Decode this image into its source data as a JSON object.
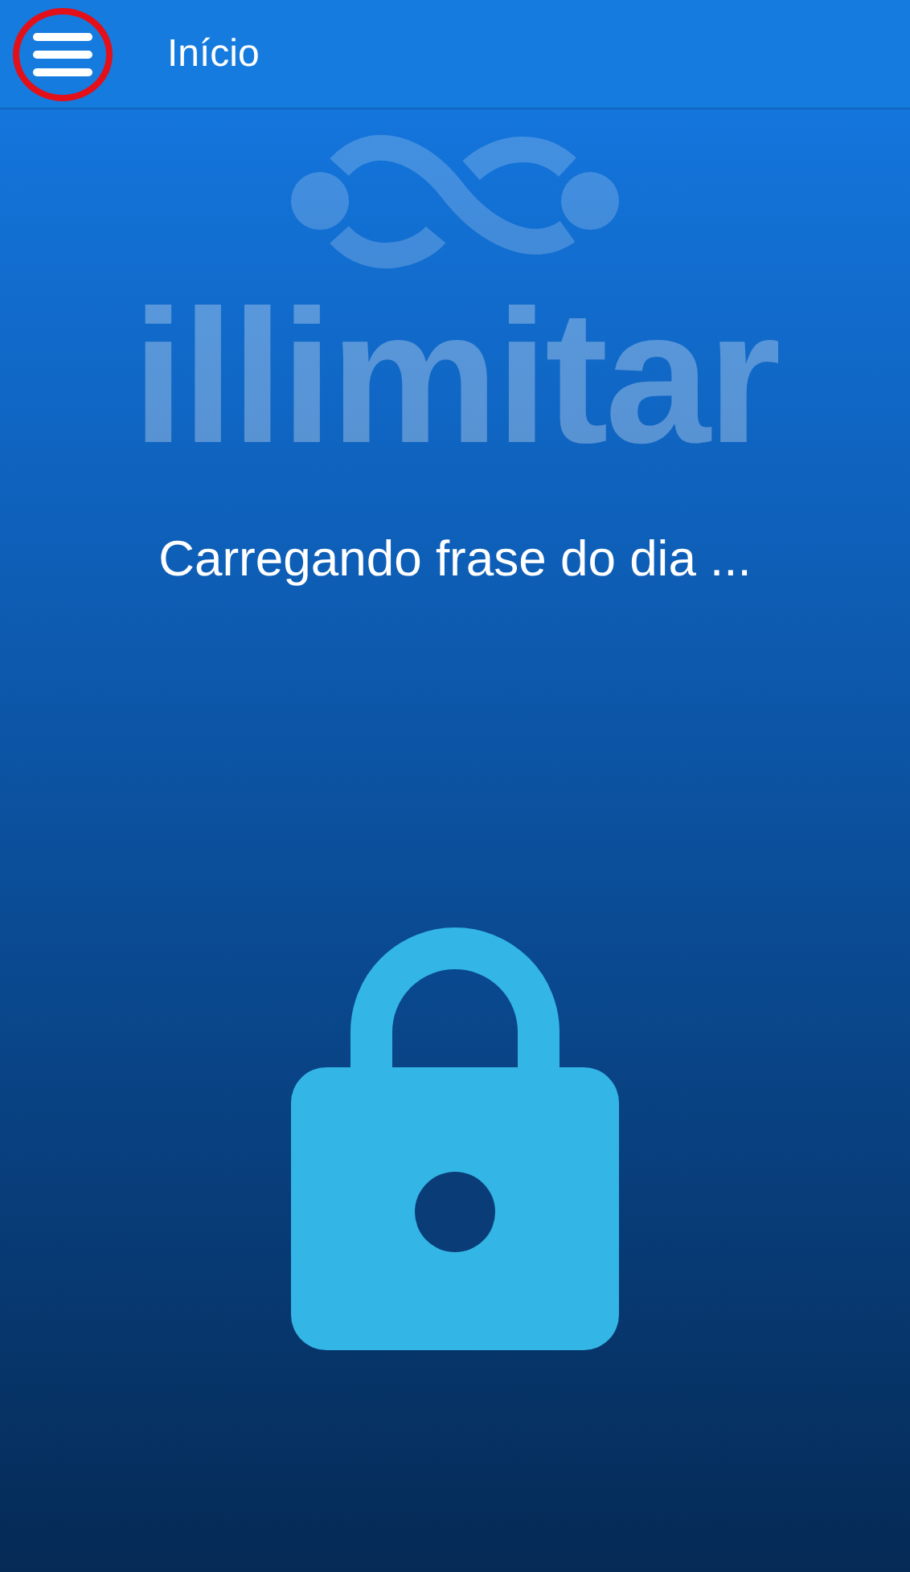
{
  "header": {
    "title": "Início",
    "menu_highlighted": true
  },
  "logo": {
    "text": "illimitar"
  },
  "message": "Carregando frase do dia ..."
}
